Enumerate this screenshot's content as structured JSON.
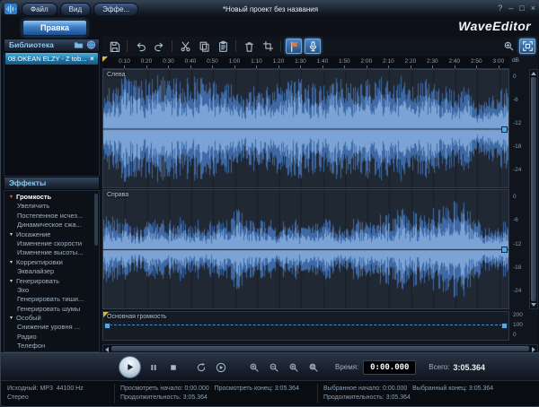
{
  "titlebar": {
    "menus": [
      "Файл",
      "Вид",
      "Эффе..."
    ],
    "title": "*Новый проект без названия",
    "window_buttons": {
      "help": "?",
      "minimize": "–",
      "maximize": "□",
      "close": "×"
    }
  },
  "header": {
    "edit_tab": "Правка",
    "logo": "WaveEditor"
  },
  "library": {
    "title": "Библиотека",
    "items": [
      {
        "label": "08.OKEAN ELZY - Z tob...",
        "selected": true
      }
    ]
  },
  "effects": {
    "title": "Эффекты",
    "items": [
      {
        "label": "Громкость",
        "group": true,
        "selected": true
      },
      {
        "label": "Увеличить"
      },
      {
        "label": "Постепенное исчез..."
      },
      {
        "label": "Динамическое сжа..."
      },
      {
        "label": "Искажение",
        "group": true
      },
      {
        "label": "Изменение скорости"
      },
      {
        "label": "Изменение высоты..."
      },
      {
        "label": "Корректировки",
        "group": true
      },
      {
        "label": "Эквалайзер"
      },
      {
        "label": "Генерировать",
        "group": true
      },
      {
        "label": "Эхо"
      },
      {
        "label": "Генерировать тиши..."
      },
      {
        "label": "Генерировать шумы"
      },
      {
        "label": "Особый",
        "group": true
      },
      {
        "label": "Снижение уровня ..."
      },
      {
        "label": "Радио"
      },
      {
        "label": "Телефон"
      }
    ]
  },
  "toolbar": {
    "left": [
      "save",
      "undo",
      "redo",
      "cut",
      "copy",
      "paste",
      "delete",
      "trim",
      "marker",
      "record"
    ],
    "right": [
      "zoom-selection",
      "fit-window"
    ],
    "active": [
      "marker",
      "record",
      "fit-window"
    ]
  },
  "timeline": {
    "ticks": [
      "0:10",
      "0:20",
      "0:30",
      "0:40",
      "0:50",
      "1:00",
      "1:10",
      "1:20",
      "1:30",
      "1:40",
      "1:50",
      "2:00",
      "2:10",
      "2:20",
      "2:30",
      "2:40",
      "2:50",
      "3:00"
    ]
  },
  "channels": [
    {
      "label": "Слева"
    },
    {
      "label": "Справа"
    }
  ],
  "db_scale": {
    "unit": "dB",
    "values": [
      "0",
      "-6",
      "-12",
      "-18",
      "-24"
    ]
  },
  "master": {
    "label": "Основная громкость",
    "scale": [
      "200",
      "100",
      "0"
    ]
  },
  "transport": {
    "buttons": [
      "play",
      "pause",
      "stop",
      "loop",
      "play-selection",
      "zoom-in",
      "zoom-out",
      "zoom-selection",
      "zoom-all"
    ],
    "time_label": "Время:",
    "time_value": "0:00.000",
    "total_label": "Всего:",
    "total_value": "3:05.364"
  },
  "statusbar": {
    "source": {
      "line1": "Исходный: MP3  44100 Hz",
      "line2": "Стерео"
    },
    "view": {
      "line1": "Просмотреть начало: 0:00.000   Просмотреть конец: 3:05.364",
      "line2": "Продолжительность: 3:05.364"
    },
    "selection": {
      "line1": "Выбранное начало: 0:00.000   Выбранный конец: 3:05.364",
      "line2": "Продолжительность: 3:05.364"
    }
  },
  "colors": {
    "accent": "#4a90d8",
    "waveform": "#3e69a4",
    "waveform_bright": "#7ba3d6",
    "selected_item": "#1f709f"
  }
}
